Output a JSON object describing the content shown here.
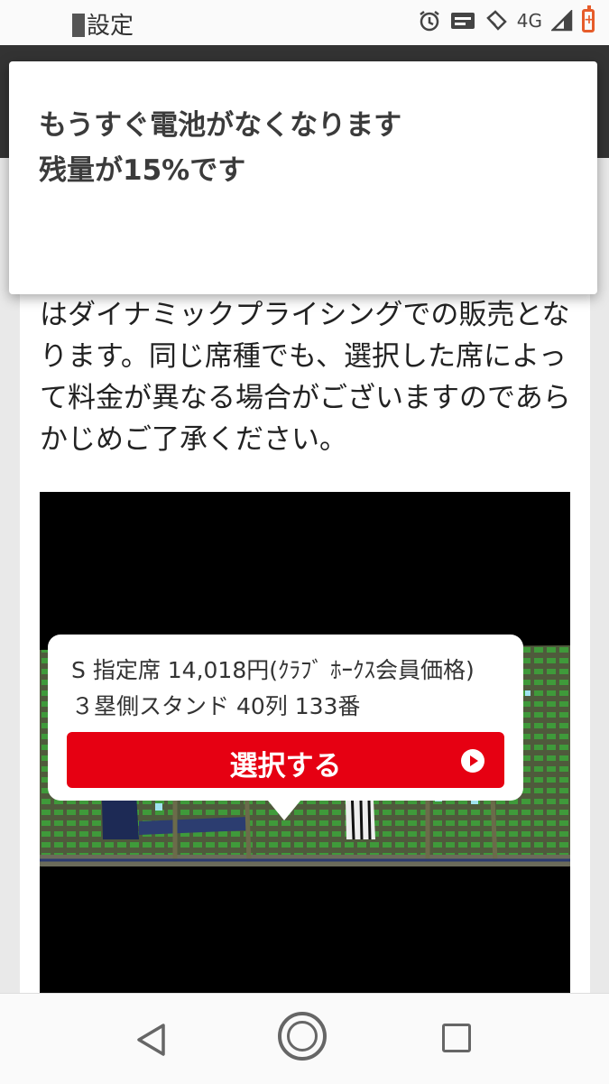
{
  "status_bar": {
    "title": "設定",
    "network": "4G"
  },
  "battery_dialog": {
    "line1": "もうすぐ電池がなくなります",
    "line2": "残量が15%です"
  },
  "notice": {
    "text": "はダイナミックプライシングでの販売となります。同じ席種でも、選択した席によって料金が異なる場合がございますのであらかじめご了承ください。"
  },
  "seat_popup": {
    "seat_type": "S 指定席 14,018円(ｸﾗﾌﾞ ﾎｰｸｽ会員価格)",
    "location": "３塁側スタンド 40列 133番",
    "select_label": "選択する"
  },
  "colors": {
    "accent_red": "#e60012",
    "battery_warning": "#e65c2a"
  },
  "icons": {
    "alarm": "alarm-icon",
    "cast": "cast-icon",
    "nfc": "nfc-icon",
    "signal": "signal-icon",
    "battery": "battery-low-icon",
    "back": "back-icon",
    "home": "home-icon",
    "recents": "recents-icon",
    "play": "play-circle-icon"
  }
}
